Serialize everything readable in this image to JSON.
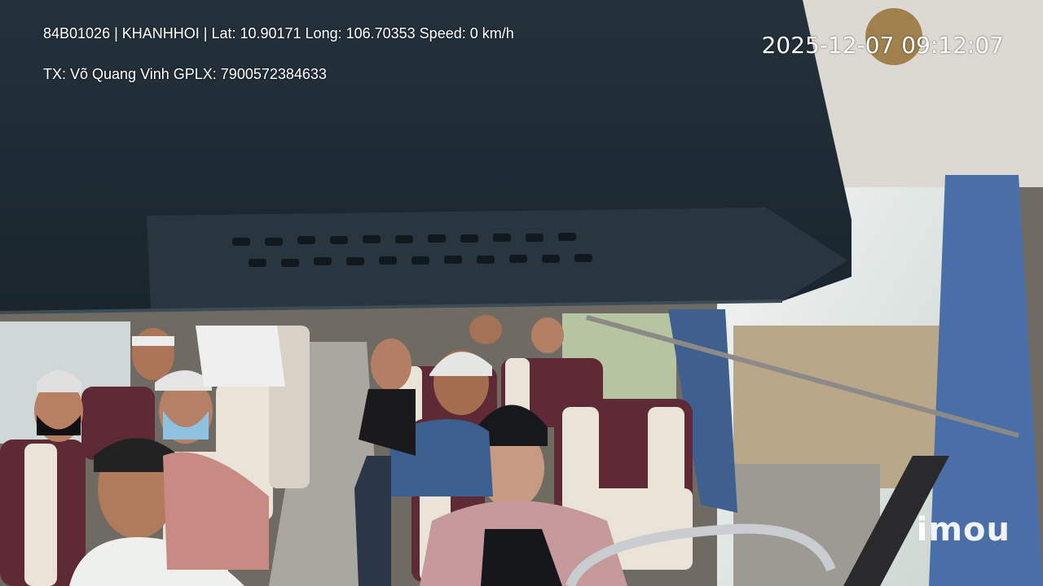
{
  "overlay": {
    "line1": "84B01026 | KHANHHOI | Lat: 10.90171 Long: 106.70353 Speed: 0 km/h",
    "line2": "TX: Võ Quang Vinh GPLX: 7900572384633",
    "timestamp": "2025-12-07 09:12:07"
  },
  "brand": {
    "logo_text": "imou"
  },
  "colors": {
    "ceiling_panel": "#1f2c36",
    "seat_maroon": "#5e2a36",
    "seat_cream": "#e9e3d8",
    "curtain_blue": "#4a6fa8",
    "window_light": "#e8eef2"
  }
}
